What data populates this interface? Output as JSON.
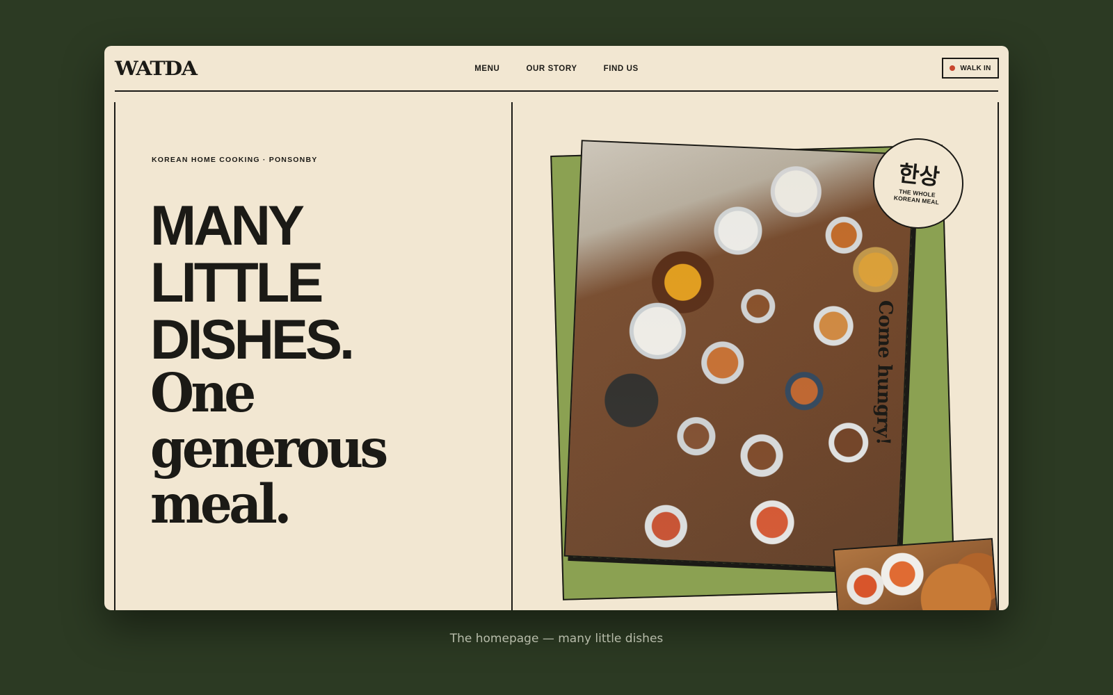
{
  "brand": {
    "logo": "WATDA"
  },
  "nav": {
    "items": [
      {
        "label": "MENU"
      },
      {
        "label": "OUR STORY"
      },
      {
        "label": "FIND US"
      }
    ],
    "cta": {
      "label": "WALK IN",
      "status_color": "#c8462d"
    }
  },
  "hero": {
    "eyebrow": "KOREAN HOME COOKING · PONSONBY",
    "headline_sans": [
      "MANY",
      "LITTLE",
      "DISHES."
    ],
    "headline_serif": [
      "One",
      "generous",
      "meal."
    ]
  },
  "badge": {
    "korean": "한상",
    "english": "THE WHOLE KOREAN MEAL"
  },
  "side_label": "Come hungry!",
  "caption": "The homepage — many little dishes",
  "colors": {
    "background": "#2c3a23",
    "card": "#f2e7d2",
    "ink": "#1b1a16",
    "accent_green": "#8ba152",
    "status_red": "#c8462d"
  }
}
